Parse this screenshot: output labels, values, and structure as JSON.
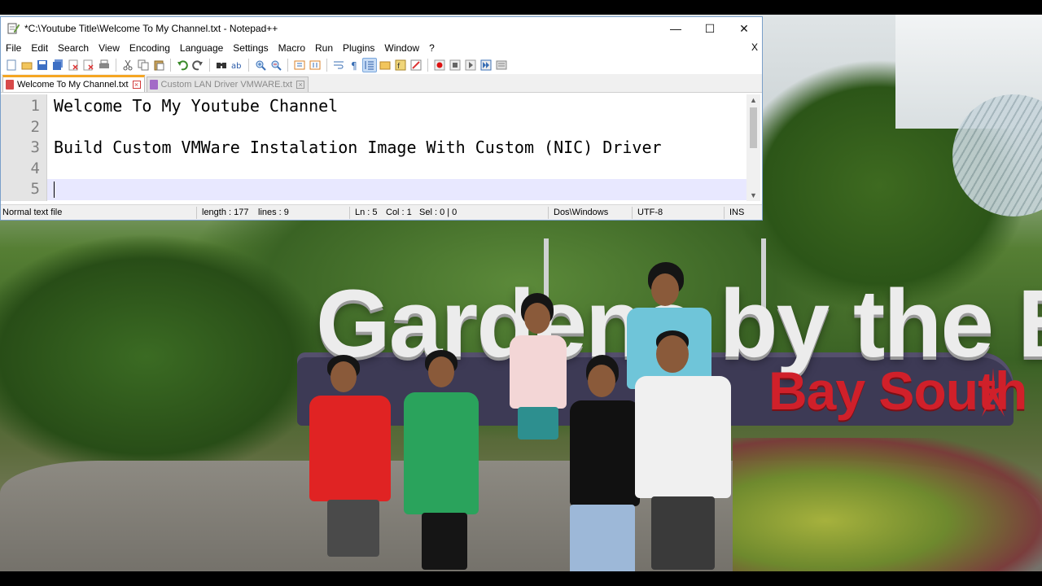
{
  "window": {
    "title": "*C:\\Youtube Title\\Welcome To My Channel.txt - Notepad++",
    "minimize": "—",
    "maximize": "☐",
    "close": "✕"
  },
  "menu": {
    "items": [
      "File",
      "Edit",
      "Search",
      "View",
      "Encoding",
      "Language",
      "Settings",
      "Macro",
      "Run",
      "Plugins",
      "Window",
      "?"
    ],
    "close_doc": "X"
  },
  "toolbar": {
    "icons": [
      "new-file-icon",
      "open-file-icon",
      "save-icon",
      "save-all-icon",
      "close-icon",
      "close-all-icon",
      "print-icon",
      "cut-icon",
      "copy-icon",
      "paste-icon",
      "undo-icon",
      "redo-icon",
      "find-icon",
      "replace-icon",
      "zoom-in-icon",
      "zoom-out-icon",
      "sync-vertical-icon",
      "sync-horizontal-icon",
      "word-wrap-icon",
      "show-all-chars-icon",
      "indent-guide-icon",
      "doc-map-icon",
      "function-list-icon",
      "folder-workspace-icon",
      "monitoring-icon",
      "record-macro-icon",
      "stop-record-icon",
      "play-macro-icon",
      "run-macro-multiple-icon",
      "save-macro-icon"
    ],
    "active": "indent-guide-icon"
  },
  "tabs": [
    {
      "label": "Welcome To My Channel.txt",
      "active": true
    },
    {
      "label": "Custom LAN Driver VMWARE.txt",
      "active": false
    }
  ],
  "editor": {
    "lines": [
      {
        "number": "1",
        "text": "Welcome To My Youtube Channel"
      },
      {
        "number": "2",
        "text": ""
      },
      {
        "number": "3",
        "text": "Build Custom VMWare Instalation Image With Custom (NIC) Driver"
      },
      {
        "number": "4",
        "text": ""
      },
      {
        "number": "5",
        "text": ""
      }
    ],
    "current_line": "5"
  },
  "status": {
    "file_type": "Normal text file",
    "length": "length : 177",
    "lines": "lines : 9",
    "ln": "Ln : 5",
    "col": "Col : 1",
    "sel": "Sel : 0 | 0",
    "eol": "Dos\\Windows",
    "encoding": "UTF-8",
    "mode": "INS"
  },
  "wallpaper": {
    "sign_title": "Gardens by the Bay",
    "sign_subtitle": "Bay South"
  },
  "colors": {
    "active_tab_accent": "#f5a623",
    "current_line_bg": "#e8e8ff",
    "sign_red": "#d0202a"
  }
}
